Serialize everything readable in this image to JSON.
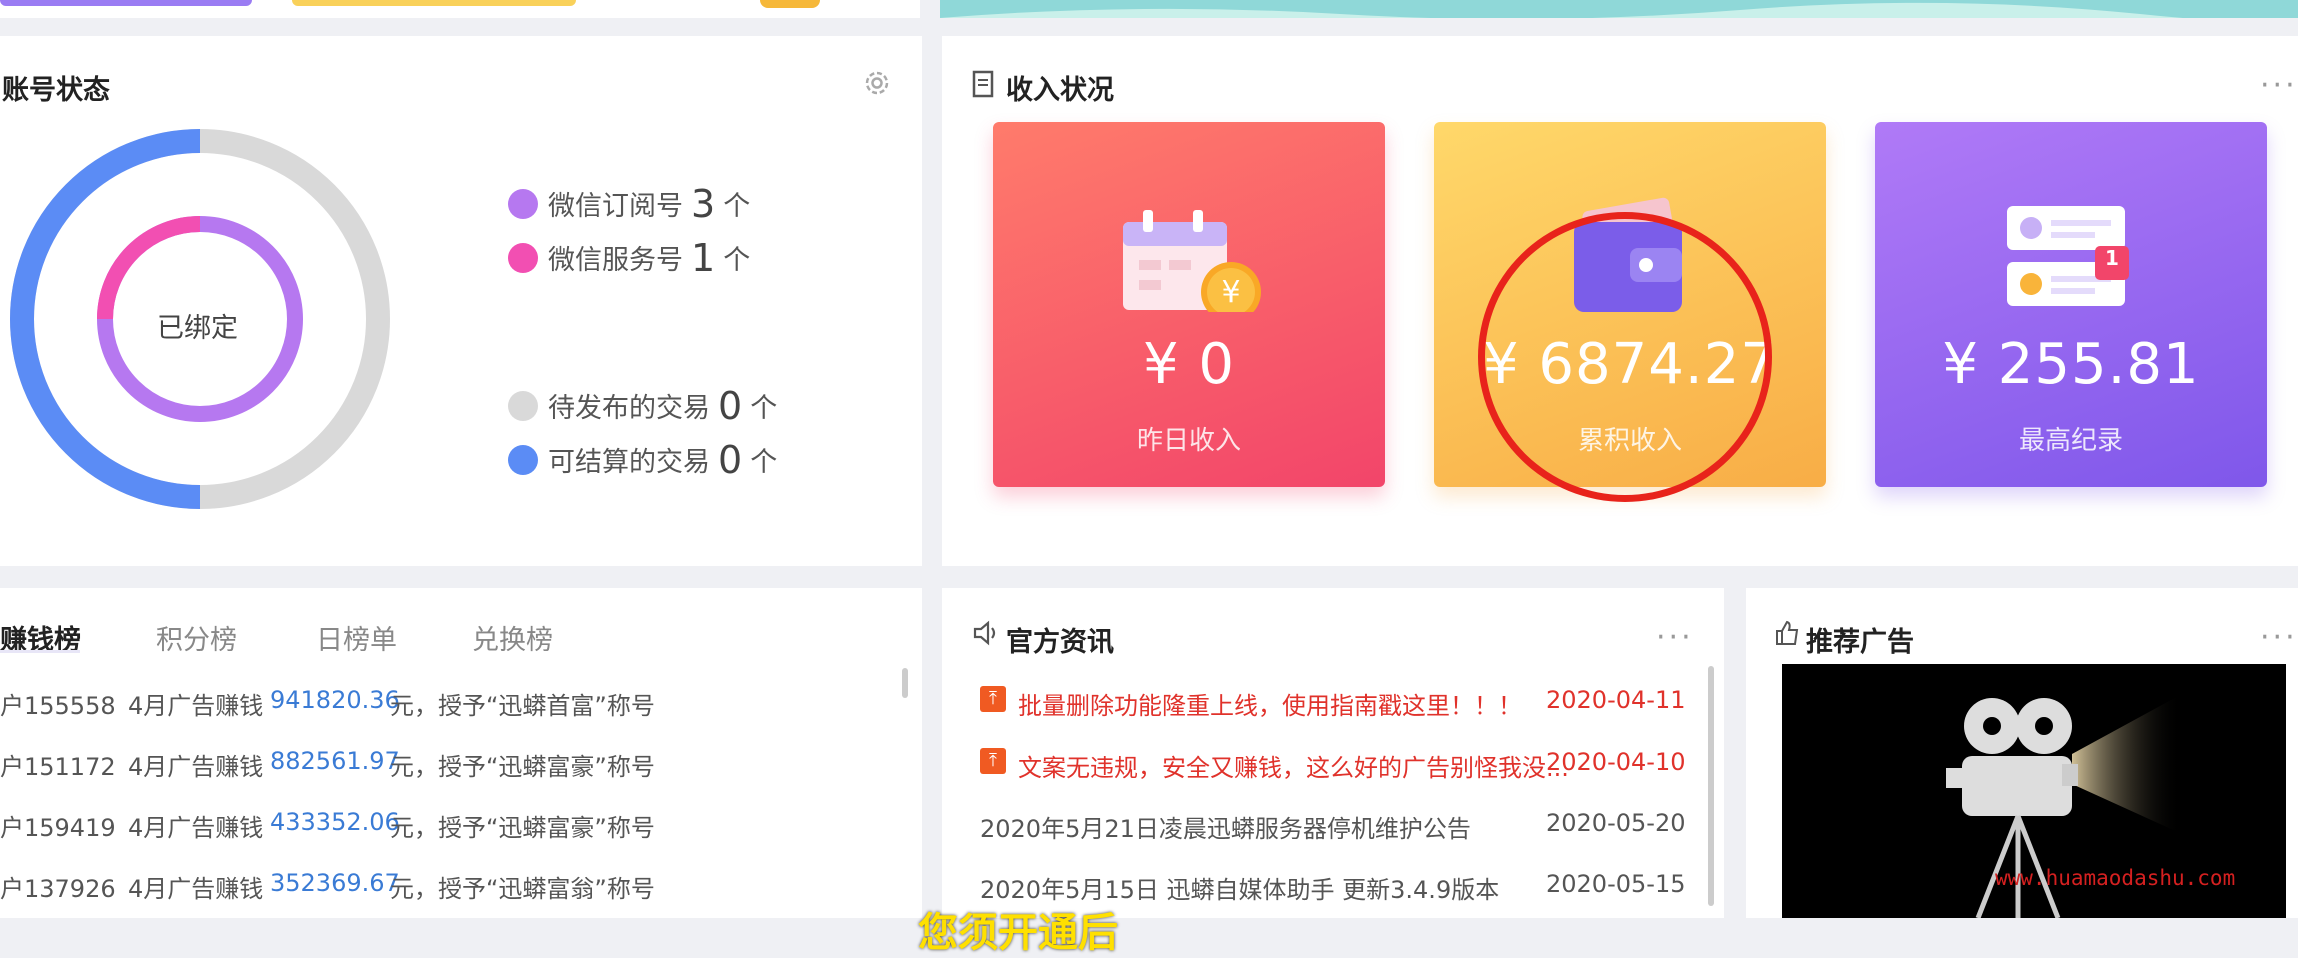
{
  "account_status": {
    "title": "账号状态",
    "donut_center": "已绑定",
    "legend": [
      {
        "label": "微信订阅号",
        "count": "3",
        "unit": "个",
        "color": "#b678f0"
      },
      {
        "label": "微信服务号",
        "count": "1",
        "unit": "个",
        "color": "#f24fb2"
      },
      {
        "label": "待发布的交易",
        "count": "0",
        "unit": "个",
        "color": "#d9d9d9"
      },
      {
        "label": "可结算的交易",
        "count": "0",
        "unit": "个",
        "color": "#5b8cf5"
      }
    ]
  },
  "income": {
    "title": "收入状况",
    "more": "···",
    "cards": [
      {
        "amount": "¥ 0",
        "label": "昨日收入",
        "icon": "calendar-coin-icon"
      },
      {
        "amount": "¥ 6874.27",
        "label": "累积收入",
        "icon": "wallet-icon"
      },
      {
        "amount": "¥ 255.81",
        "label": "最高纪录",
        "icon": "record-cards-icon",
        "badge": "1"
      }
    ]
  },
  "ranking": {
    "tabs": [
      "赚钱榜",
      "积分榜",
      "日榜单",
      "兑换榜"
    ],
    "rows": [
      {
        "user": "户155558",
        "text": "4月广告赚钱",
        "value": "941820.36",
        "suffix": "元，授予“迅蟒首富”称号"
      },
      {
        "user": "户151172",
        "text": "4月广告赚钱",
        "value": "882561.97",
        "suffix": "元，授予“迅蟒富豪”称号"
      },
      {
        "user": "户159419",
        "text": "4月广告赚钱",
        "value": "433352.06",
        "suffix": "元，授予“迅蟒富豪”称号"
      },
      {
        "user": "户137926",
        "text": "4月广告赚钱",
        "value": "352369.67",
        "suffix": "元，授予“迅蟒富翁”称号"
      }
    ]
  },
  "news": {
    "title": "官方资讯",
    "more": "···",
    "items": [
      {
        "text": "批量删除功能隆重上线，使用指南戳这里！！！",
        "date": "2020-04-11",
        "pinned": true
      },
      {
        "text": "文案无违规，安全又赚钱，这么好的广告别怪我没...",
        "date": "2020-04-10",
        "pinned": true
      },
      {
        "text": "2020年5月21日凌晨迅蟒服务器停机维护公告",
        "date": "2020-05-20",
        "pinned": false
      },
      {
        "text": "2020年5月15日 迅蟒自媒体助手 更新3.4.9版本",
        "date": "2020-05-15",
        "pinned": false
      }
    ]
  },
  "ads": {
    "title": "推荐广告",
    "more": "···"
  },
  "overlay": {
    "watermark": "www.huamaodashu.com",
    "subtitle": "您须开通后"
  }
}
